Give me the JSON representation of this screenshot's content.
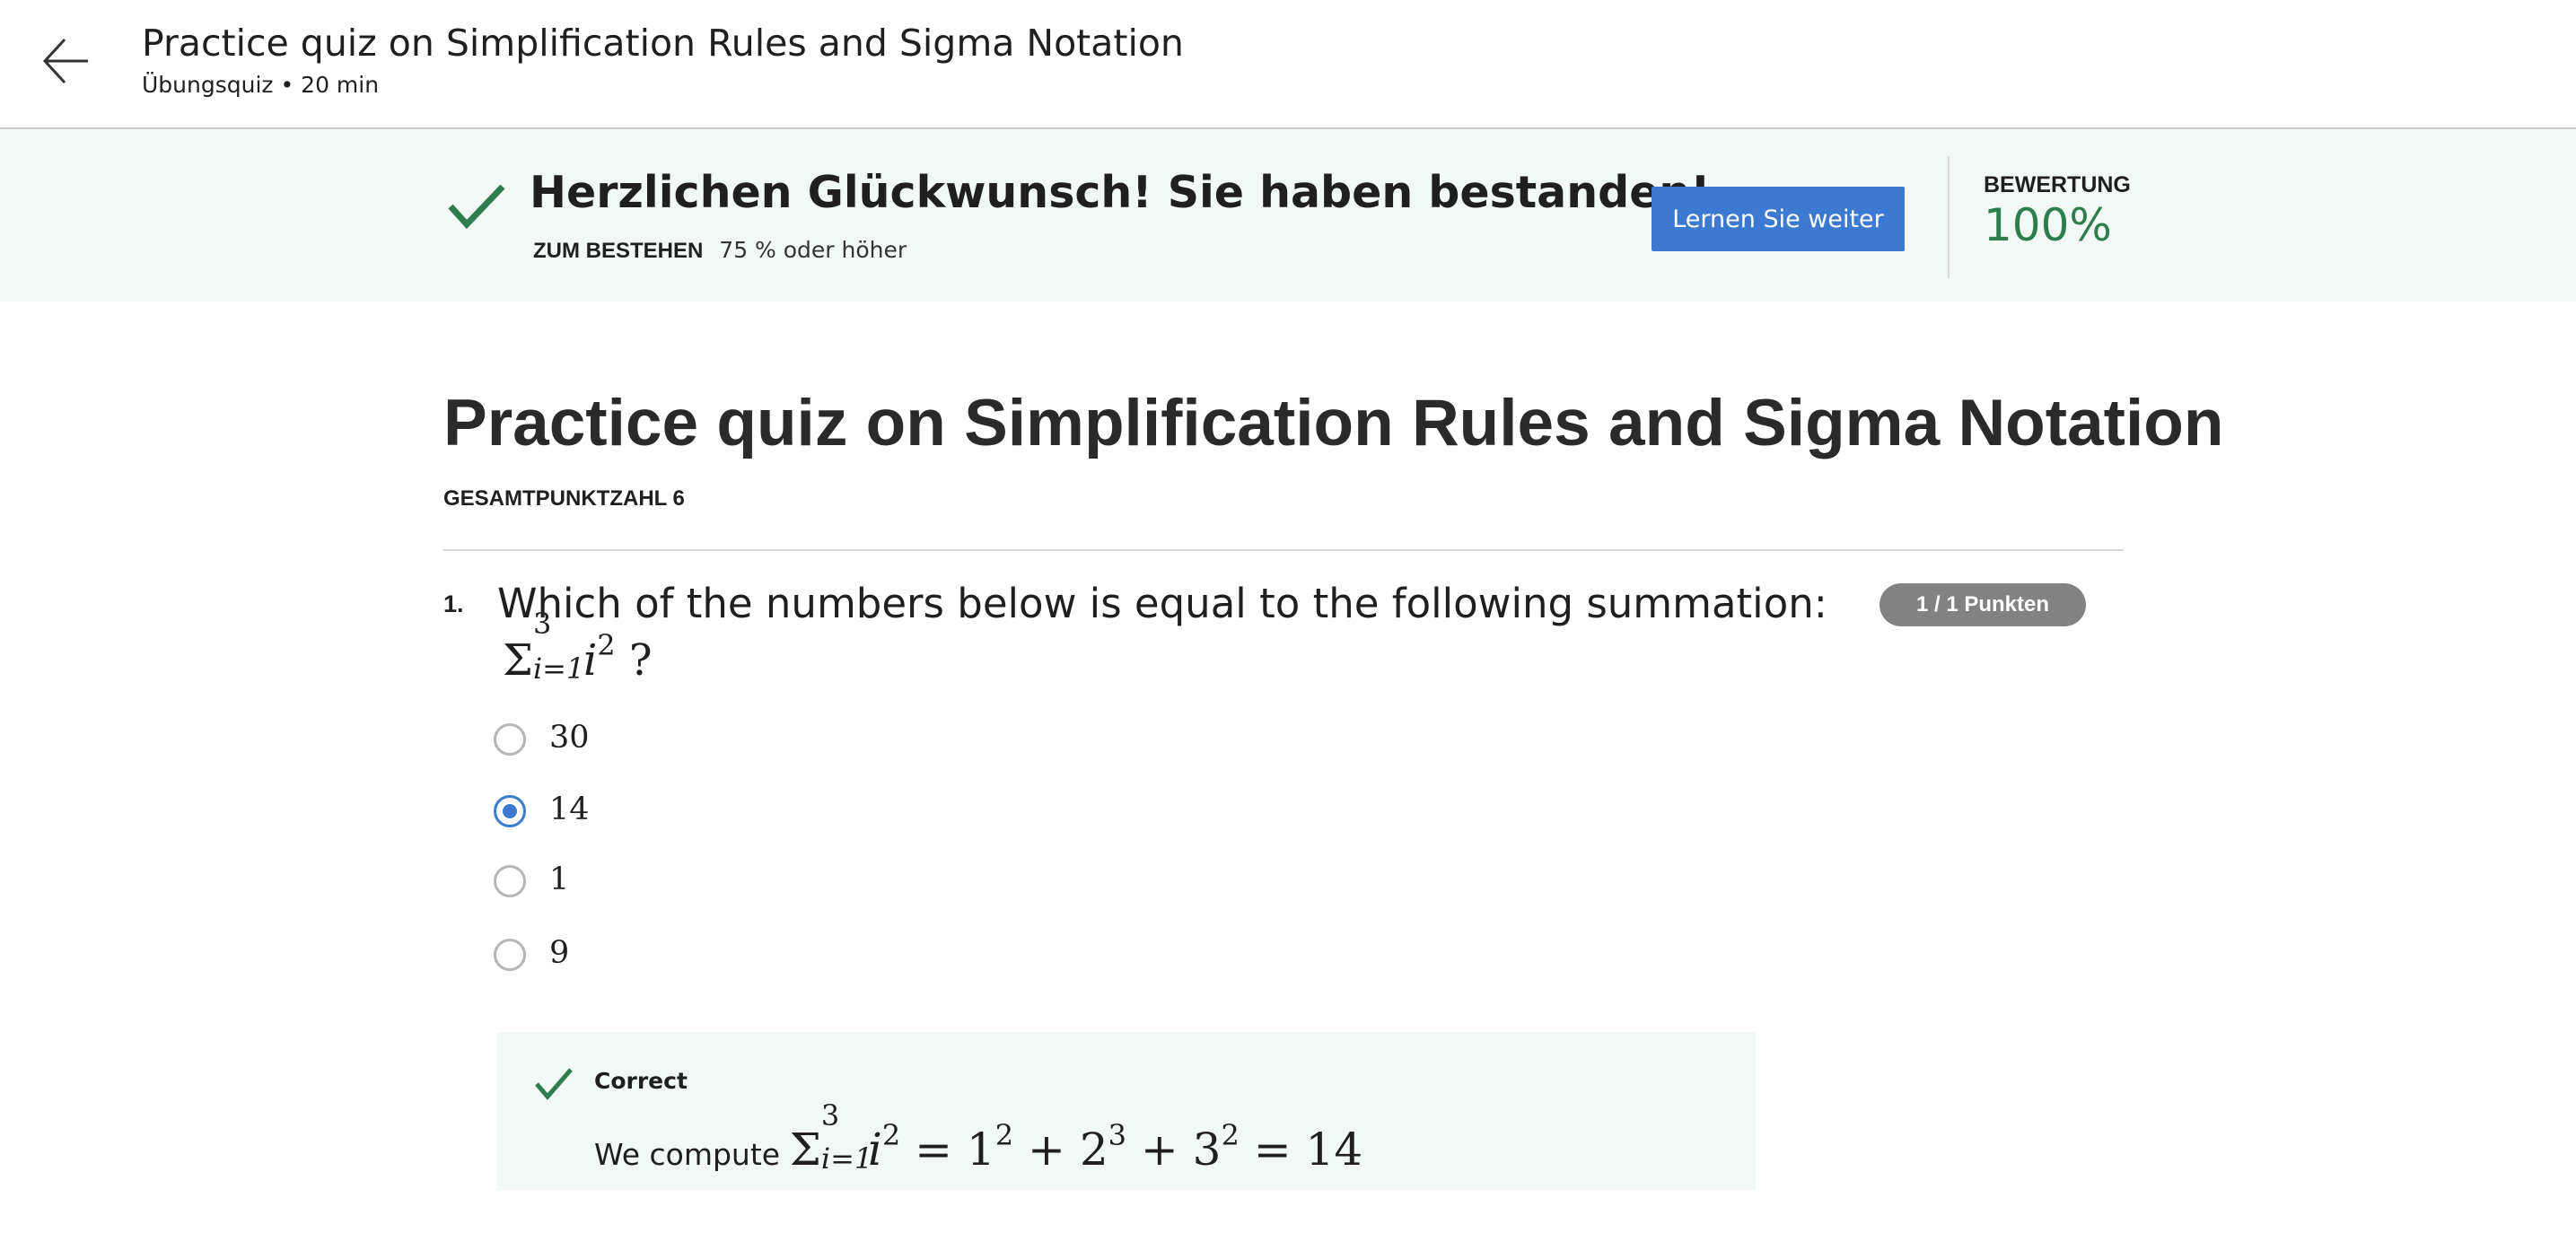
{
  "header": {
    "back_icon": "arrow-left-icon",
    "title": "Practice quiz on Simplification Rules and Sigma Notation",
    "subtitle": "Übungsquiz • 20 min"
  },
  "banner": {
    "check_icon": "checkmark-icon",
    "headline": "Herzlichen Glückwunsch! Sie haben bestanden!",
    "pass_label": "ZUM BESTEHEN",
    "pass_value": "75 % oder höher",
    "continue_button": "Lernen Sie weiter",
    "grade_label": "BEWERTUNG",
    "grade_value": "100%",
    "colors": {
      "background": "#f2f8f6",
      "accent_green": "#2e7d4f",
      "button_blue": "#3b7ad0"
    }
  },
  "quiz": {
    "title": "Practice quiz on Simplification Rules and Sigma Notation",
    "total_points": "GESAMTPUNKTZAHL 6"
  },
  "question": {
    "number": "1.",
    "text": "Which of the numbers below is equal to the following summation:",
    "math": {
      "sigma": "Σ",
      "upper": "3",
      "lower": "i=1",
      "var": "i",
      "power": "2",
      "tail": " ?"
    },
    "points": "1 / 1 Punkten",
    "options": [
      {
        "label": "30",
        "selected": false
      },
      {
        "label": "14",
        "selected": true
      },
      {
        "label": "1",
        "selected": false
      },
      {
        "label": "9",
        "selected": false
      }
    ]
  },
  "feedback": {
    "status": "Correct",
    "prefix": "We compute ",
    "math": {
      "sigma": "Σ",
      "upper": "3",
      "lower": "i=1",
      "var": "i",
      "power": "2",
      "expr_1": " = 1",
      "p1": "2",
      "expr_2": " + 2",
      "p2": "3",
      "expr_3": " + 3",
      "p3": "2",
      "expr_4": " = 14"
    }
  }
}
